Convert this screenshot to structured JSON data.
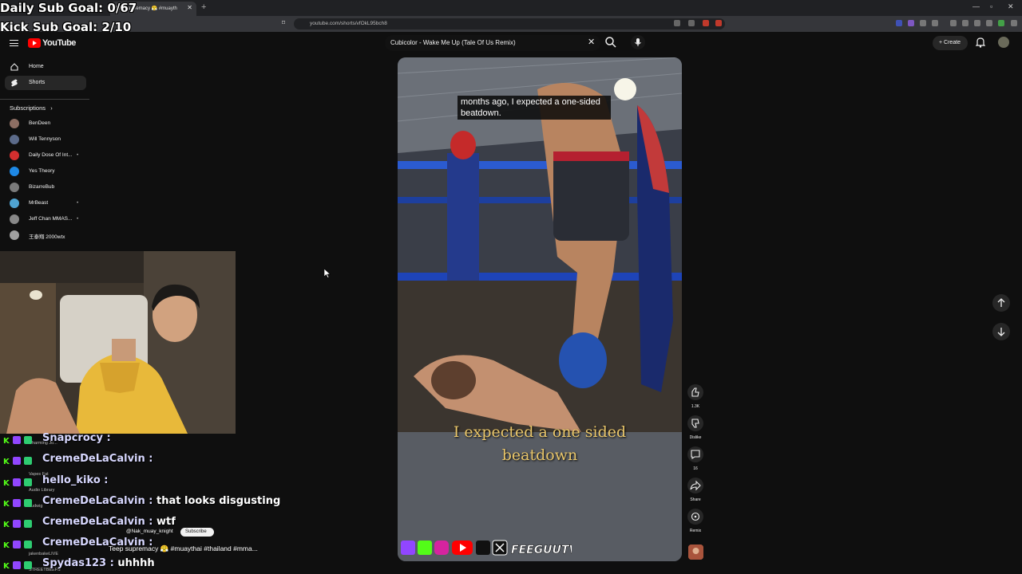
{
  "browser": {
    "tab_title": "Teep supremacy 😤 #muayth",
    "url": "youtube.com/shorts/vfOkL95bch8"
  },
  "overlay": {
    "daily_goal": "Daily Sub Goal: 0/67",
    "kick_goal": "Kick Sub Goal: 2/10"
  },
  "header": {
    "logo_text": "YouTube",
    "search_value": "Cubicolor - Wake Me Up (Tale Of Us Remix)",
    "create_label": "Create"
  },
  "sidebar": {
    "nav": [
      {
        "label": "Home",
        "icon": "home-icon"
      },
      {
        "label": "Shorts",
        "icon": "shorts-icon"
      }
    ],
    "subscriptions_label": "Subscriptions",
    "subscriptions": [
      {
        "name": "BenDeen",
        "color": "#8d6e63",
        "dot": ""
      },
      {
        "name": "Will Tennyson",
        "color": "#5c6b8a",
        "dot": ""
      },
      {
        "name": "Daily Dose Of Int...",
        "color": "#d32f2f",
        "dot": "•"
      },
      {
        "name": "Yes Theory",
        "color": "#1e88e5",
        "dot": ""
      },
      {
        "name": "BizarreBub",
        "color": "#7a7a7a",
        "dot": ""
      },
      {
        "name": "MrBeast",
        "color": "#4fa3d1",
        "dot": "•"
      },
      {
        "name": "Jeff Chan MMAS...",
        "color": "#888888",
        "dot": "•"
      },
      {
        "name": "王泰翔 2000wtx",
        "color": "#a0a0a0",
        "dot": ""
      }
    ]
  },
  "chat": [
    {
      "user": "Snapcrocy :",
      "msg": ""
    },
    {
      "user": "CremeDeLaCalvin :",
      "msg": ""
    },
    {
      "user": "hello_kiko :",
      "msg": ""
    },
    {
      "user": "CremeDeLaCalvin :",
      "msg": "that looks disgusting"
    },
    {
      "user": "CremeDeLaCalvin :",
      "msg": "wtf"
    },
    {
      "user": "CremeDeLaCalvin :",
      "msg": ""
    },
    {
      "user": "Spydas123 :",
      "msg": "uhhhh"
    }
  ],
  "chat_ghosts": [
    "Charming Jo...",
    "Vapes Fat",
    "Audio Library",
    "Ludwig",
    "jakenbakeLIVE",
    "STREETBEEFS"
  ],
  "short": {
    "caption_top": "months ago, I expected a one-sided beatdown.",
    "caption_burned": "I expected a one sided beatdown",
    "watermark": "FEEGUUTV",
    "channel": "@Nak_muay_knight",
    "subscribe_label": "Subscribe",
    "title": "Teep supremacy 😤 #muaythai #thailand #mma..."
  },
  "actions": [
    {
      "icon": "thumbs-up-icon",
      "label": "1.3K"
    },
    {
      "icon": "thumbs-down-icon",
      "label": "Dislike"
    },
    {
      "icon": "comment-icon",
      "label": "16"
    },
    {
      "icon": "share-icon",
      "label": "Share"
    },
    {
      "icon": "remix-icon",
      "label": "Remix"
    }
  ],
  "colors": {
    "accent": "#ff0000",
    "background": "#0f0f0f",
    "caption_gold": "#e9c66a"
  }
}
